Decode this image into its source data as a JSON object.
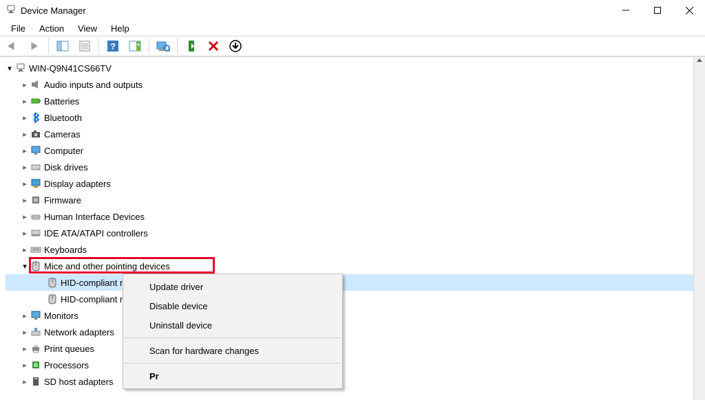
{
  "window": {
    "title": "Device Manager"
  },
  "menubar": [
    "File",
    "Action",
    "View",
    "Help"
  ],
  "toolbar": {
    "back": "Back",
    "forward": "Forward",
    "show_hide_console": "Show/Hide Console Tree",
    "properties": "Properties",
    "help": "Help",
    "action_center": "Action",
    "scan_monitor": "Scan for hardware changes",
    "enable": "Enable device",
    "uninstall_x": "Uninstall device",
    "scan_arrow": "Scan"
  },
  "tree": {
    "root": "WIN-Q9N41CS66TV",
    "categories": [
      {
        "label": "Audio inputs and outputs",
        "icon": "speaker"
      },
      {
        "label": "Batteries",
        "icon": "battery"
      },
      {
        "label": "Bluetooth",
        "icon": "bluetooth"
      },
      {
        "label": "Cameras",
        "icon": "camera"
      },
      {
        "label": "Computer",
        "icon": "monitor"
      },
      {
        "label": "Disk drives",
        "icon": "disk"
      },
      {
        "label": "Display adapters",
        "icon": "display"
      },
      {
        "label": "Firmware",
        "icon": "chip"
      },
      {
        "label": "Human Interface Devices",
        "icon": "hid"
      },
      {
        "label": "IDE ATA/ATAPI controllers",
        "icon": "ide"
      },
      {
        "label": "Keyboards",
        "icon": "keyboard"
      },
      {
        "label": "Mice and other pointing devices",
        "icon": "mouse",
        "expanded": true,
        "children": [
          {
            "label": "HID-compliant mouse",
            "icon": "mouse",
            "selected": true,
            "truncated": true
          },
          {
            "label": "HID-compliant m",
            "icon": "mouse",
            "truncated": true
          }
        ]
      },
      {
        "label": "Monitors",
        "icon": "monitor"
      },
      {
        "label": "Network adapters",
        "icon": "network"
      },
      {
        "label": "Print queues",
        "icon": "printer"
      },
      {
        "label": "Processors",
        "icon": "cpu"
      },
      {
        "label": "SD host adapters",
        "icon": "sd"
      }
    ]
  },
  "context_menu": {
    "update": "Update driver",
    "disable": "Disable device",
    "uninstall": "Uninstall device",
    "scan": "Scan for hardware changes",
    "properties_truncated": "Pr"
  }
}
